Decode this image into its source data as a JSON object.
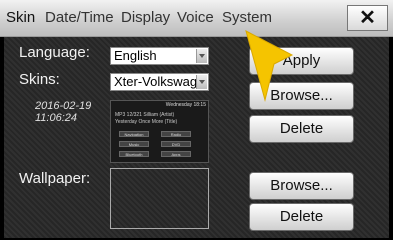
{
  "tabs": [
    {
      "label": "Skin"
    },
    {
      "label": "Date/Time"
    },
    {
      "label": "Display"
    },
    {
      "label": "Voice"
    },
    {
      "label": "System"
    }
  ],
  "close_label": "✕",
  "language": {
    "label": "Language:",
    "value": "English"
  },
  "skins": {
    "label": "Skins:",
    "value": "Xter-Volkswage"
  },
  "date": "2016-02-19",
  "time": "11:06:24",
  "preview": {
    "header": "Wednesday     18:15",
    "line1": "MP3 12/321    Silliam (Artist)",
    "line2": "Yesterday Once More (Title)",
    "cells": [
      "Navigation",
      "Radio",
      "Music",
      "DVD",
      "Bluetooth",
      "Apps"
    ]
  },
  "wallpaper": {
    "label": "Wallpaper:"
  },
  "buttons": {
    "apply": "Apply",
    "browse_skin": "Browse...",
    "delete_skin": "Delete",
    "browse_wallpaper": "Browse...",
    "delete_wallpaper": "Delete"
  },
  "colors": {
    "pointer": "#f5c400",
    "header_bg": "#d6d6d6",
    "panel_bg": "#2b2b2b"
  }
}
